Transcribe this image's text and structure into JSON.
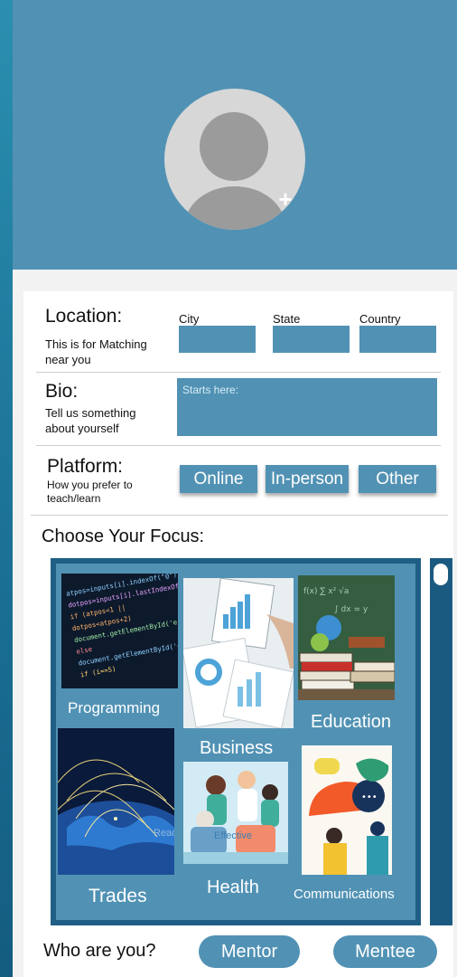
{
  "profile": {
    "avatar_icon": "user-avatar-placeholder",
    "add_icon": "plus-icon",
    "add_glyph": "+"
  },
  "location": {
    "label": "Location:",
    "help": "This is for Matching near you",
    "city_label": "City",
    "state_label": "State",
    "country_label": "Country",
    "city_value": "",
    "state_value": "",
    "country_value": ""
  },
  "bio": {
    "label": "Bio:",
    "help": "Tell us something about yourself",
    "placeholder": "Starts here:"
  },
  "platform": {
    "label": "Platform:",
    "help": "How you prefer to teach/learn",
    "options": [
      "Online",
      "In-person",
      "Other"
    ]
  },
  "focus": {
    "title": "Choose Your Focus:",
    "tiles": [
      {
        "label": "Programming"
      },
      {
        "label": "Business"
      },
      {
        "label": "Education"
      },
      {
        "label": "Trades",
        "overlay": "Read"
      },
      {
        "label": "Health",
        "overlay": "Effective"
      },
      {
        "label": "Communications"
      }
    ],
    "code_lines": [
      "atpos=inputs[i].indexOf(\"@\");",
      "dotpos=inputs[i].lastIndexOf(\".\");",
      "if (atpos<1 || dotpos<atpos+2)",
      "document.getElementById('errEmail')",
      "else",
      "document.getElementById('errEmail')",
      "if (i==5)"
    ]
  },
  "who": {
    "label": "Who are you?",
    "options": [
      "Mentor",
      "Mentee"
    ]
  },
  "colors": {
    "accent": "#5192b4",
    "dark": "#1f5f85",
    "page_bg": "#f2f2f2"
  }
}
